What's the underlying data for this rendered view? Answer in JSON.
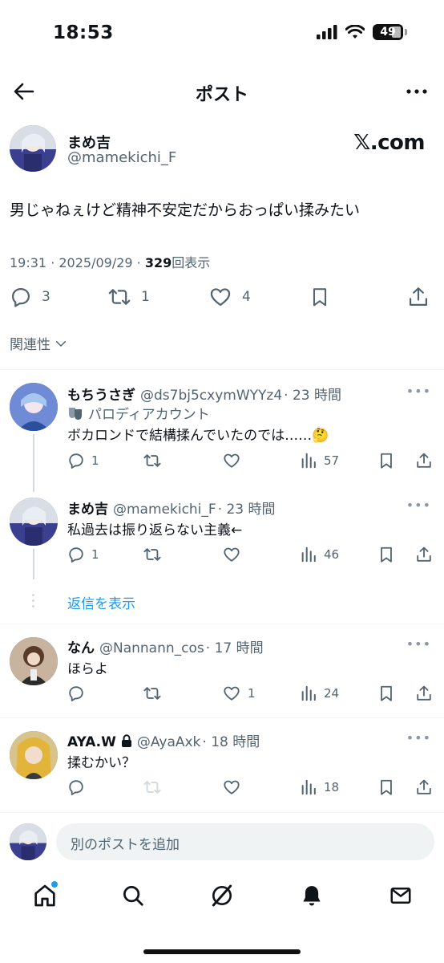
{
  "status_bar": {
    "time": "18:53",
    "battery": "49"
  },
  "header": {
    "title": "ポスト"
  },
  "post": {
    "author_name": "まめ吉",
    "author_handle": "@mamekichi_F",
    "brand": "𝕏.com",
    "text": "男じゃねぇけど精神不安定だからおっぱい揉みたい",
    "time": "19:31 · 2025/09/29 · ",
    "views": "329",
    "views_label": "回表示",
    "replies": "3",
    "reposts": "1",
    "likes": "4"
  },
  "sort_label": "関連性",
  "replies": [
    {
      "name": "もちうさぎ",
      "handle": "@ds7bj5cxymWYYz4",
      "time": "· 23 時間",
      "badge": "パロディアカウント",
      "text": "ボカロンドで結構揉んでいたのでは……🤔",
      "replies": "1",
      "reposts": "",
      "likes": "",
      "views": "57"
    },
    {
      "name": "まめ吉",
      "handle": "@mamekichi_F",
      "time": "· 23 時間",
      "text": "私過去は振り返らない主義←",
      "replies": "1",
      "reposts": "",
      "likes": "",
      "views": "46"
    },
    {
      "name": "なん",
      "handle": "@Nannann_cos",
      "time": "· 17 時間",
      "text": "ほらよ",
      "replies": "",
      "reposts": "",
      "likes": "1",
      "views": "24"
    },
    {
      "name": "AYA.W",
      "handle": "@AyaAxk",
      "time": "· 18 時間",
      "text": "揉むかい？",
      "replies": "",
      "reposts": "",
      "likes": "",
      "views": "18"
    }
  ],
  "show_replies": "返信を表示",
  "compose": {
    "placeholder": "別のポストを追加"
  },
  "colors": {
    "accent": "#1d9bf0",
    "text": "#0f1419",
    "muted": "#536471"
  },
  "icons": [
    "back-arrow-icon",
    "more-icon",
    "reply-icon",
    "repost-icon",
    "like-icon",
    "bookmark-icon",
    "share-icon",
    "views-icon",
    "chevron-down-icon",
    "lock-icon",
    "mask-icon",
    "home-icon",
    "search-icon",
    "grok-icon",
    "bell-icon",
    "mail-icon"
  ]
}
